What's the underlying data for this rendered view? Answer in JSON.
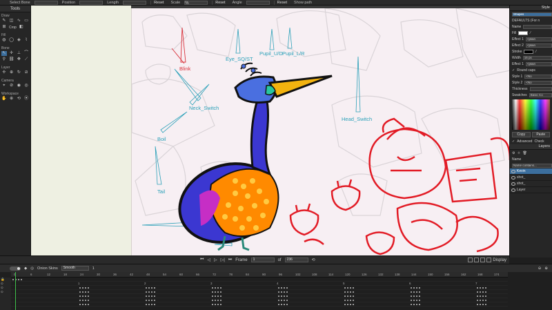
{
  "topbar": {
    "select_bone": "Select Bone",
    "position": "Position",
    "length": "Length",
    "reset1": "Reset",
    "scale": "Scale",
    "scale_value": "%",
    "reset2": "Reset",
    "angle": "Angle",
    "reset3": "Reset",
    "show_path": "Show path"
  },
  "tools": {
    "title": "Tools",
    "groups": [
      {
        "label": "Draw"
      },
      {
        "label": "Fill"
      },
      {
        "label": "Bone"
      },
      {
        "label": "Layer"
      },
      {
        "label": "Camera"
      },
      {
        "label": "Workspace"
      }
    ],
    "crop_label": "Crop"
  },
  "canvas": {
    "rig_labels": {
      "blink": "Blink",
      "eye_sq_st": "Eye_SQ/ST",
      "pupil_ud": "Pupil_U/D",
      "pupil_lr": "Pupil_L/R",
      "neck_switch": "Neck_Switch",
      "head_switch": "Head_Switch",
      "boil": "Boil",
      "tail": "Tail"
    }
  },
  "right_panel": {
    "style_tab": "Style",
    "shapes_tab": "Shapes",
    "defaults": "DEFAULTS (For n",
    "name_label": "Name",
    "fill_label": "Fill",
    "effect1_label": "Effect 1",
    "effect1_value": "<plain",
    "effect2_label": "Effect 2",
    "effect2_value": "<plain",
    "stroke_label": "Stroke",
    "width_label": "Width",
    "width_value": "16 px",
    "effect1b_label": "Effect 1",
    "effect1b_value": "<plain",
    "round_caps": "Round caps",
    "style1_label": "Style 1",
    "style1_value": "<No",
    "style2_label": "Style 2",
    "style2_value": "<No",
    "thickness_label": "Thickness",
    "swatches_label": "Swatches",
    "swatches_value": "Basic Co",
    "copy_btn": "Copy",
    "paste_btn": "Paste",
    "advanced": "Advanced",
    "check": "Check",
    "layers_tab": "Layers",
    "name_col": "Name",
    "name_contains": "Name contains...",
    "layers": [
      {
        "name": "Kevin",
        "active": true
      },
      {
        "name": "shot_",
        "active": false
      },
      {
        "name": "shot_",
        "active": false
      },
      {
        "name": "Layer",
        "active": false
      }
    ]
  },
  "playback": {
    "frame_label": "Frame",
    "frame_value": "1",
    "of_label": "of",
    "total_frames": "236",
    "display_label": "Display"
  },
  "timeline": {
    "onion_skins": "Onion Skins",
    "interpolation": "Smooth",
    "value": "1",
    "ruler_ticks": [
      "0",
      "6",
      "12",
      "18",
      "24",
      "30",
      "36",
      "42",
      "48",
      "54",
      "60",
      "66",
      "72",
      "78",
      "84",
      "90",
      "96",
      "102",
      "108",
      "114",
      "120",
      "126",
      "132",
      "138",
      "144",
      "150",
      "156",
      "162",
      "168",
      "174"
    ],
    "markers": [
      "1",
      "2",
      "3",
      "4",
      "5",
      "6",
      "7"
    ]
  },
  "colors": {
    "accent": "#3c6f9e",
    "playhead": "#3ec24a",
    "rig_cyan": "#2aa0b8",
    "rig_red": "#d8303a",
    "character_red": "#e21b25"
  }
}
